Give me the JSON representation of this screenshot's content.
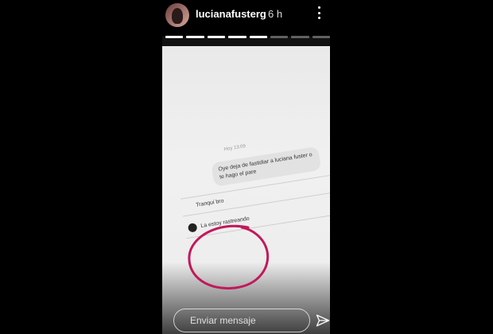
{
  "header": {
    "username": "lucianafusterg",
    "time_ago": "6 h",
    "segments_total": 8,
    "segments_complete": 5
  },
  "chat": {
    "timestamp": "Hoy 13:09",
    "outgoing_message": "Oye deja de fastidiar a luciana fuster o te hago el pare",
    "reply_1": "Tranqui bro",
    "reply_2": "La estoy rastreando"
  },
  "footer": {
    "message_placeholder": "Enviar mensaje"
  },
  "colors": {
    "annotation_circle": "#c2185b",
    "background": "#000000"
  },
  "icons": [
    "more-vertical-icon",
    "send-icon"
  ]
}
